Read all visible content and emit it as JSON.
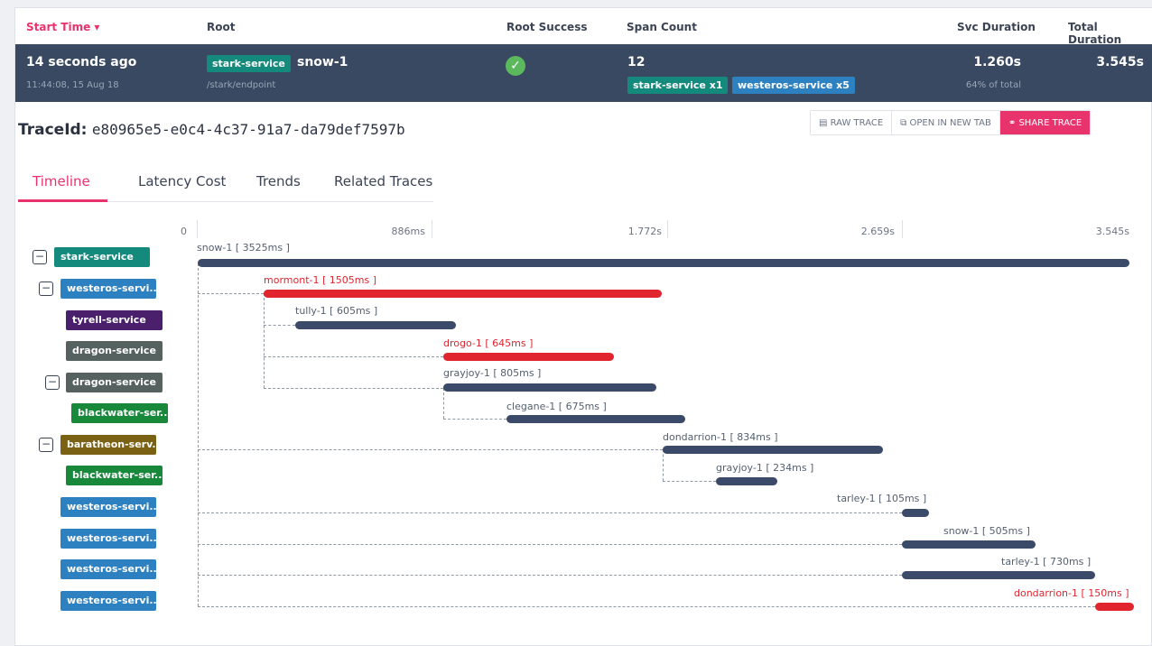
{
  "header": {
    "start_time": "Start Time ▾",
    "root": "Root",
    "root_success": "Root Success",
    "span_count": "Span Count",
    "svc_duration": "Svc Duration",
    "total_duration": "Total Duration"
  },
  "summary": {
    "time_ago": "14 seconds ago",
    "timestamp": "11:44:08, 15 Aug 18",
    "root_service": "stark-service",
    "root_name": "snow-1",
    "root_path": "/stark/endpoint",
    "success_icon": "check-icon",
    "span_count": "12",
    "services": [
      "stark-service x1",
      "westeros-service x5"
    ],
    "svc_duration": "1.260s",
    "svc_percent": "64% of total",
    "total_duration": "3.545s"
  },
  "trace": {
    "label": "TraceId:",
    "id": "e80965e5-e0c4-4c37-91a7-da79def7597b"
  },
  "buttons": {
    "raw": "RAW TRACE",
    "open": "OPEN IN NEW TAB",
    "share": "SHARE TRACE"
  },
  "tabs": [
    "Timeline",
    "Latency Cost",
    "Trends",
    "Related Traces"
  ],
  "ruler": [
    "0",
    "886ms",
    "1.772s",
    "2.659s",
    "3.545s"
  ],
  "services": [
    {
      "name": "stark-service",
      "color": "#138a7c"
    },
    {
      "name": "westeros-servi...",
      "color": "#2e81c1"
    },
    {
      "name": "tyrell-service",
      "color": "#4a1f6b"
    },
    {
      "name": "dragon-service",
      "color": "#56625f"
    },
    {
      "name": "dragon-service",
      "color": "#56625f"
    },
    {
      "name": "blackwater-ser...",
      "color": "#18883b"
    },
    {
      "name": "baratheon-serv...",
      "color": "#7a6114"
    },
    {
      "name": "blackwater-ser...",
      "color": "#18883b"
    },
    {
      "name": "westeros-servi...",
      "color": "#2e81c1"
    },
    {
      "name": "westeros-servi...",
      "color": "#2e81c1"
    },
    {
      "name": "westeros-servi...",
      "color": "#2e81c1"
    },
    {
      "name": "westeros-servi...",
      "color": "#2e81c1"
    }
  ],
  "spans": [
    {
      "label": "snow-1 [ 3525ms ]",
      "error": false
    },
    {
      "label": "mormont-1 [ 1505ms ]",
      "error": true
    },
    {
      "label": "tully-1 [ 605ms ]",
      "error": false
    },
    {
      "label": "drogo-1 [ 645ms ]",
      "error": true
    },
    {
      "label": "grayjoy-1 [ 805ms ]",
      "error": false
    },
    {
      "label": "clegane-1 [ 675ms ]",
      "error": false
    },
    {
      "label": "dondarrion-1 [ 834ms ]",
      "error": false
    },
    {
      "label": "grayjoy-1 [ 234ms ]",
      "error": false
    },
    {
      "label": "tarley-1 [ 105ms ]",
      "error": false
    },
    {
      "label": "snow-1 [ 505ms ]",
      "error": false
    },
    {
      "label": "tarley-1 [ 730ms ]",
      "error": false
    },
    {
      "label": "dondarrion-1 [ 150ms ]",
      "error": true
    }
  ]
}
